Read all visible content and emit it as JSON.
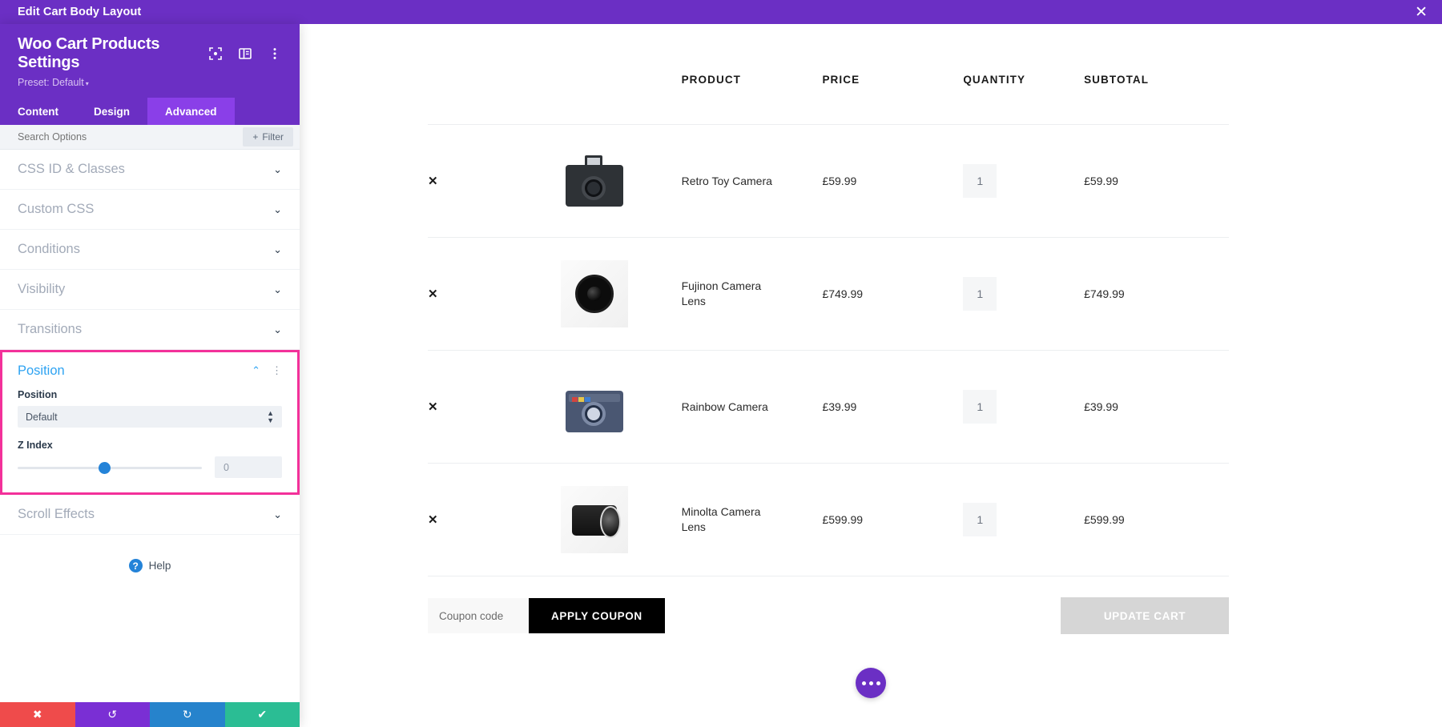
{
  "topbar": {
    "title": "Edit Cart Body Layout",
    "close_icon": "close-icon",
    "close_glyph": "✕"
  },
  "panel": {
    "heading": "Woo Cart Products Settings",
    "preset_label": "Preset: Default",
    "preset_caret": "▾",
    "header_icons": [
      "focus-target-icon",
      "layout-columns-icon",
      "vertical-dots-icon"
    ],
    "tabs": [
      {
        "label": "Content",
        "active": false
      },
      {
        "label": "Design",
        "active": false
      },
      {
        "label": "Advanced",
        "active": true
      }
    ],
    "search": {
      "placeholder": "Search Options",
      "value": ""
    },
    "filter_button": {
      "label": "Filter",
      "plus": "+"
    },
    "options": [
      {
        "label": "CSS ID & Classes",
        "chevron": "⌄"
      },
      {
        "label": "Custom CSS",
        "chevron": "⌄"
      },
      {
        "label": "Conditions",
        "chevron": "⌄"
      },
      {
        "label": "Visibility",
        "chevron": "⌄"
      },
      {
        "label": "Transitions",
        "chevron": "⌄"
      }
    ],
    "position_section": {
      "title": "Position",
      "chevron_up": "⌃",
      "options_dots": "⋮",
      "highlight_color": "#f3319a",
      "accent_color": "#2ea3f2",
      "position_field": {
        "label": "Position",
        "value": "Default",
        "arrows": "⇅"
      },
      "zindex_field": {
        "label": "Z Index",
        "value": "0",
        "slider_percent": 44,
        "knob_color": "#2483d8"
      }
    },
    "scroll_effects": {
      "label": "Scroll Effects",
      "chevron": "⌄"
    },
    "help": {
      "label": "Help",
      "icon_glyph": "?"
    },
    "footer_buttons": [
      {
        "name": "cancel-button",
        "glyph": "✖",
        "color": "#ef4b4b"
      },
      {
        "name": "undo-button",
        "glyph": "↺",
        "color": "#7a2fd4"
      },
      {
        "name": "redo-button",
        "glyph": "↻",
        "color": "#2683cc"
      },
      {
        "name": "save-button",
        "glyph": "✔",
        "color": "#2bbd94"
      }
    ]
  },
  "cart": {
    "columns": [
      "",
      "",
      "PRODUCT",
      "PRICE",
      "QUANTITY",
      "SUBTOTAL"
    ],
    "remove_glyph": "✕",
    "rows": [
      {
        "name": "Retro Toy Camera",
        "price": "£59.99",
        "qty": "1",
        "subtotal": "£59.99",
        "thumb": "retro-toy-camera-thumb"
      },
      {
        "name": "Fujinon Camera Lens",
        "price": "£749.99",
        "qty": "1",
        "subtotal": "£749.99",
        "thumb": "fujinon-camera-lens-thumb"
      },
      {
        "name": "Rainbow Camera",
        "price": "£39.99",
        "qty": "1",
        "subtotal": "£39.99",
        "thumb": "rainbow-camera-thumb"
      },
      {
        "name": "Minolta Camera Lens",
        "price": "£599.99",
        "qty": "1",
        "subtotal": "£599.99",
        "thumb": "minolta-camera-lens-thumb"
      }
    ],
    "coupon": {
      "placeholder": "Coupon code",
      "value": ""
    },
    "apply_coupon_label": "APPLY COUPON",
    "update_cart_label": "UPDATE CART",
    "fab": {
      "name": "more-options-fab",
      "dots": 3
    }
  }
}
